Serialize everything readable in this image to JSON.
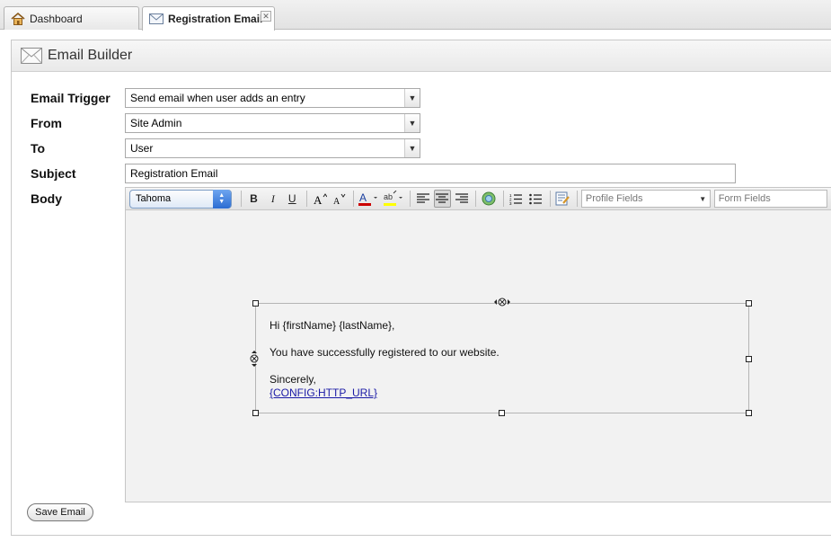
{
  "tabs": [
    {
      "label": "Dashboard",
      "icon": "home-icon",
      "active": false
    },
    {
      "label": "Registration Email",
      "icon": "envelope-icon",
      "active": true
    }
  ],
  "panel": {
    "title": "Email Builder",
    "icon": "envelope-icon"
  },
  "form": {
    "trigger": {
      "label": "Email Trigger",
      "value": "Send email when user adds an entry"
    },
    "from": {
      "label": "From",
      "value": "Site Admin"
    },
    "to": {
      "label": "To",
      "value": "User"
    },
    "subject": {
      "label": "Subject",
      "value": "Registration Email"
    },
    "body": {
      "label": "Body"
    }
  },
  "toolbar": {
    "font": "Tahoma",
    "bold": "B",
    "italic": "I",
    "underline": "U",
    "profile_fields": "Profile Fields",
    "form_fields": "Form Fields"
  },
  "email": {
    "greeting": "Hi {firstName} {lastName},",
    "message": "You have successfully registered to our website.",
    "closing": "Sincerely,",
    "link": "{CONFIG:HTTP_URL}"
  },
  "actions": {
    "save_label": "Save Email"
  },
  "colors": {
    "font_color_swatch": "#cc0000",
    "highlight_swatch": "#ffff00",
    "accent": "#2b6cd2"
  }
}
